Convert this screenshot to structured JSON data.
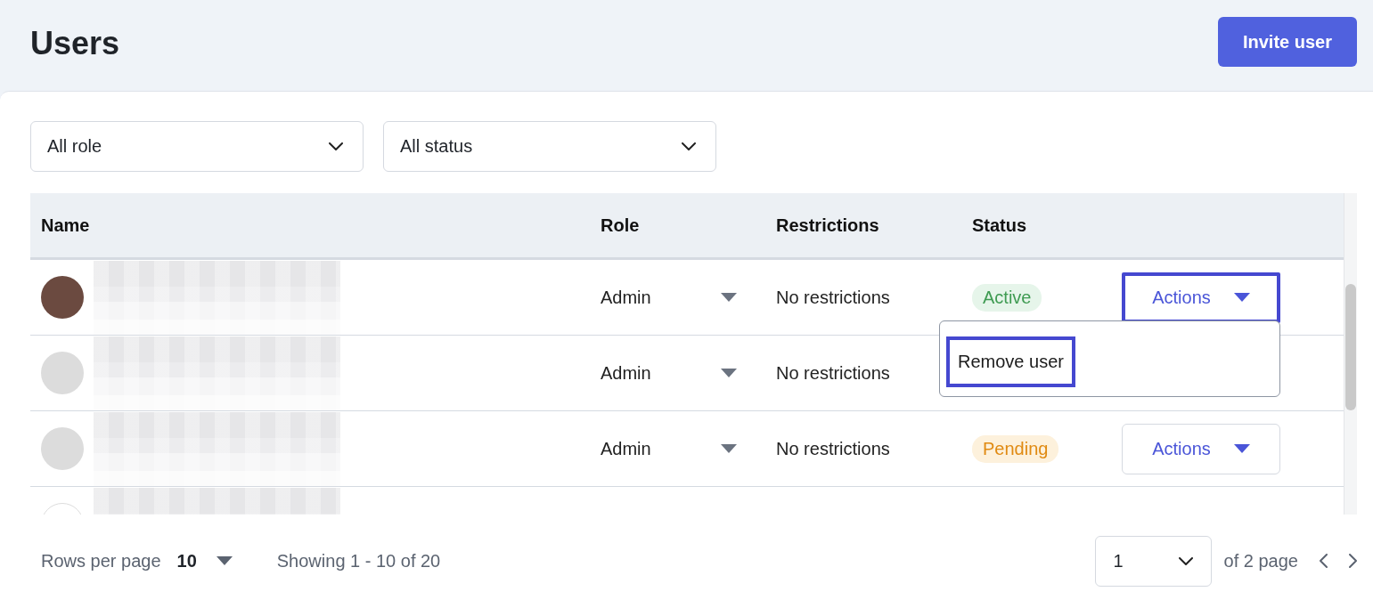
{
  "header": {
    "title": "Users",
    "invite_button": "Invite user"
  },
  "filters": [
    {
      "value": "All role"
    },
    {
      "value": "All status"
    }
  ],
  "table": {
    "columns": [
      "Name",
      "Role",
      "Restrictions",
      "Status"
    ],
    "rows": [
      {
        "avatar": {
          "kind": "photo"
        },
        "role": "Admin",
        "restrictions": "No restrictions",
        "status": {
          "label": "Active",
          "kind": "active"
        },
        "actions": {
          "label": "Actions",
          "focused": true
        }
      },
      {
        "avatar": {
          "kind": "default"
        },
        "role": "Admin",
        "restrictions": "No restrictions"
      },
      {
        "avatar": {
          "kind": "default"
        },
        "role": "Admin",
        "restrictions": "No restrictions",
        "status": {
          "label": "Pending",
          "kind": "pending"
        },
        "actions": {
          "label": "Actions",
          "focused": false
        }
      },
      {
        "avatar": {
          "kind": "image"
        }
      }
    ]
  },
  "menu": {
    "items": [
      {
        "label": "Remove user",
        "focused": true
      }
    ]
  },
  "footer": {
    "rows_per_page_label": "Rows per page",
    "rows_per_page": "10",
    "showing": "Showing 1 - 10 of 20",
    "page": "1",
    "page_total": "of 2 page"
  }
}
